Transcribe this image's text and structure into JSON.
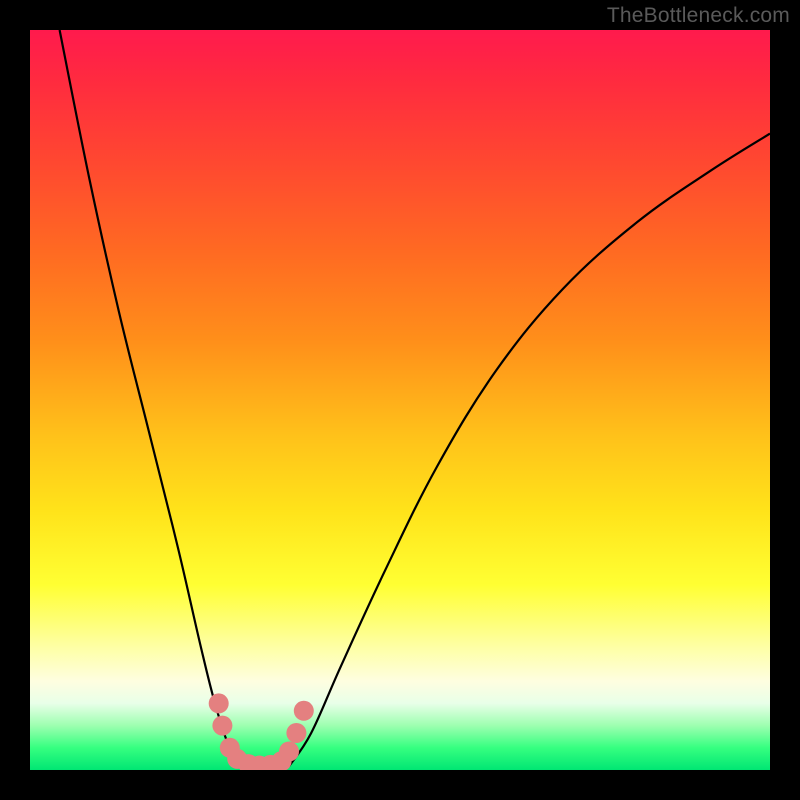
{
  "watermark": "TheBottleneck.com",
  "chart_data": {
    "type": "line",
    "title": "",
    "xlabel": "",
    "ylabel": "",
    "xlim": [
      0,
      100
    ],
    "ylim": [
      0,
      100
    ],
    "background_gradient_stops": [
      {
        "pct": 0,
        "color": "#ff1a4d"
      },
      {
        "pct": 18,
        "color": "#ff4830"
      },
      {
        "pct": 42,
        "color": "#ff8f1a"
      },
      {
        "pct": 65,
        "color": "#ffe31a"
      },
      {
        "pct": 83,
        "color": "#feffa0"
      },
      {
        "pct": 94,
        "color": "#9dffb0"
      },
      {
        "pct": 100,
        "color": "#00e673"
      }
    ],
    "series": [
      {
        "name": "left-curve",
        "stroke": "#000000",
        "points": [
          {
            "x": 4,
            "y": 100
          },
          {
            "x": 8,
            "y": 80
          },
          {
            "x": 12,
            "y": 62
          },
          {
            "x": 16,
            "y": 46
          },
          {
            "x": 20,
            "y": 30
          },
          {
            "x": 23,
            "y": 17
          },
          {
            "x": 25,
            "y": 9
          },
          {
            "x": 27,
            "y": 3
          },
          {
            "x": 29,
            "y": 0.5
          }
        ]
      },
      {
        "name": "right-curve",
        "stroke": "#000000",
        "points": [
          {
            "x": 35,
            "y": 0.5
          },
          {
            "x": 38,
            "y": 5
          },
          {
            "x": 42,
            "y": 14
          },
          {
            "x": 48,
            "y": 27
          },
          {
            "x": 55,
            "y": 41
          },
          {
            "x": 63,
            "y": 54
          },
          {
            "x": 72,
            "y": 65
          },
          {
            "x": 82,
            "y": 74
          },
          {
            "x": 92,
            "y": 81
          },
          {
            "x": 100,
            "y": 86
          }
        ]
      }
    ],
    "markers": {
      "name": "valley-dots",
      "color": "#e48080",
      "radius_approx": 10,
      "points": [
        {
          "x": 25.5,
          "y": 9
        },
        {
          "x": 26.0,
          "y": 6
        },
        {
          "x": 27.0,
          "y": 3
        },
        {
          "x": 28.0,
          "y": 1.5
        },
        {
          "x": 29.5,
          "y": 0.8
        },
        {
          "x": 31.0,
          "y": 0.6
        },
        {
          "x": 32.5,
          "y": 0.7
        },
        {
          "x": 34.0,
          "y": 1.2
        },
        {
          "x": 35.0,
          "y": 2.5
        },
        {
          "x": 36.0,
          "y": 5
        },
        {
          "x": 37.0,
          "y": 8
        }
      ]
    }
  }
}
